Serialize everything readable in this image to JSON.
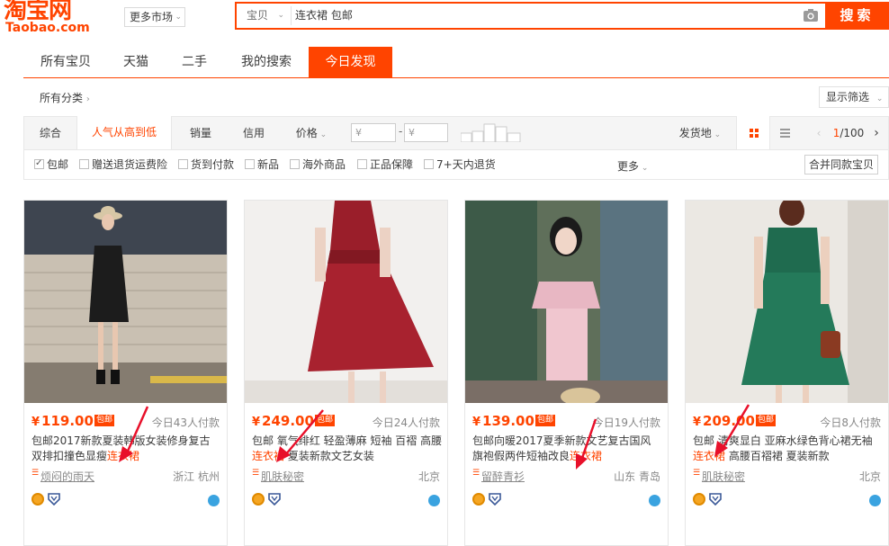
{
  "header": {
    "logo_cn": "淘宝网",
    "logo_en": "Taobao.com",
    "market_label": "更多市场",
    "scope_label": "宝贝",
    "query": "连衣裙 包邮",
    "search_button": "搜索"
  },
  "tabs": [
    {
      "label": "所有宝贝"
    },
    {
      "label": "天猫"
    },
    {
      "label": "二手"
    },
    {
      "label": "我的搜索"
    },
    {
      "label": "今日发现",
      "active": true
    }
  ],
  "category": {
    "all_label": "所有分类",
    "show_filter": "显示筛选"
  },
  "sort": {
    "items": [
      "综合",
      "人气从高到低",
      "销量",
      "信用",
      "价格"
    ],
    "active": "人气从高到低",
    "price_min_placeholder": "¥",
    "price_max_placeholder": "¥",
    "ship_from": "发货地",
    "page_current": "1",
    "page_total": "/100"
  },
  "filters": {
    "items": [
      {
        "label": "包邮",
        "checked": true
      },
      {
        "label": "赠送退货运费险",
        "checked": false
      },
      {
        "label": "货到付款",
        "checked": false
      },
      {
        "label": "新品",
        "checked": false
      },
      {
        "label": "海外商品",
        "checked": false
      },
      {
        "label": "正品保障",
        "checked": false
      },
      {
        "label": "7+天内退货",
        "checked": false
      }
    ],
    "more": "更多",
    "merge": "合并同款宝贝"
  },
  "products": [
    {
      "price": "119.00",
      "badge": "包邮",
      "paid": "今日43人付款",
      "title_line1": "包邮2017新款夏装韩版女装修身复古",
      "title_line2_pre": "双排扣撞色显瘦",
      "title_line2_hl": "连衣裙",
      "title_line2_post": "",
      "shop": "烦闷的雨天",
      "location": "浙江 杭州"
    },
    {
      "price": "249.00",
      "badge": "包邮",
      "paid": "今日24人付款",
      "title_line1": "包邮 氧气绯红 轻盈薄麻 短袖 百褶 高腰",
      "title_line2_pre": "",
      "title_line2_hl": "连衣裙",
      "title_line2_post": " 夏装新款文艺女装",
      "shop": "肌肤秘密",
      "location": "北京"
    },
    {
      "price": "139.00",
      "badge": "包邮",
      "paid": "今日19人付款",
      "title_line1": "包邮向暖2017夏季新款文艺复古国风",
      "title_line2_pre": "旗袍假两件短袖改良",
      "title_line2_hl": "连衣裙",
      "title_line2_post": "",
      "shop": "留醉青衫",
      "location": "山东 青岛"
    },
    {
      "price": "209.00",
      "badge": "包邮",
      "paid": "今日8人付款",
      "title_line1": "包邮 清爽显白 亚麻水绿色背心裙无袖",
      "title_line2_pre": "",
      "title_line2_hl": "连衣裙",
      "title_line2_post": " 高腰百褶裙 夏装新款",
      "shop": "肌肤秘密",
      "location": "北京"
    }
  ],
  "colors": {
    "accent": "#ff4400",
    "arrow": "#e8102a"
  }
}
